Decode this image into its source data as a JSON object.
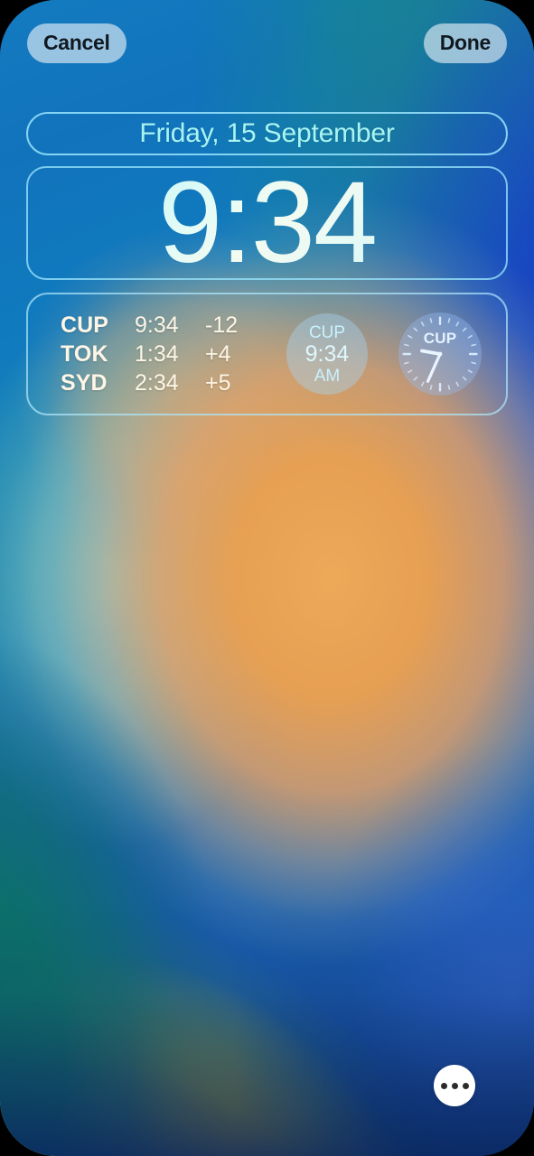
{
  "screen": {
    "name": "ios-lock-screen-customize"
  },
  "topbar": {
    "cancel_label": "Cancel",
    "done_label": "Done"
  },
  "lockscreen": {
    "date": "Friday, 15 September",
    "time": "9:34",
    "widgets": {
      "world_clock_list": {
        "columns": [
          "city",
          "time",
          "offset"
        ],
        "rows": [
          {
            "city": "CUP",
            "time": "9:34",
            "offset": "-12"
          },
          {
            "city": "TOK",
            "time": "1:34",
            "offset": "+4"
          },
          {
            "city": "SYD",
            "time": "2:34",
            "offset": "+5"
          }
        ]
      },
      "circular_digital": {
        "city": "CUP",
        "time": "9:34",
        "ampm": "AM"
      },
      "circular_analog": {
        "city": "CUP",
        "hour_hand_deg": 280,
        "minute_hand_deg": 204
      }
    }
  },
  "bottom": {
    "more_button_label": "more-options",
    "dot_count": 3
  },
  "colors": {
    "date_text": "#a8f4f2",
    "time_text": "#dffdfa",
    "slot_border": "#96e1fa",
    "button_bg": "#ecf4f8",
    "button_text": "#111820",
    "world_clock_text": "#fdf6e6",
    "circle_widget_bg": "#a6d6fa",
    "more_button_bg": "#ffffff"
  }
}
